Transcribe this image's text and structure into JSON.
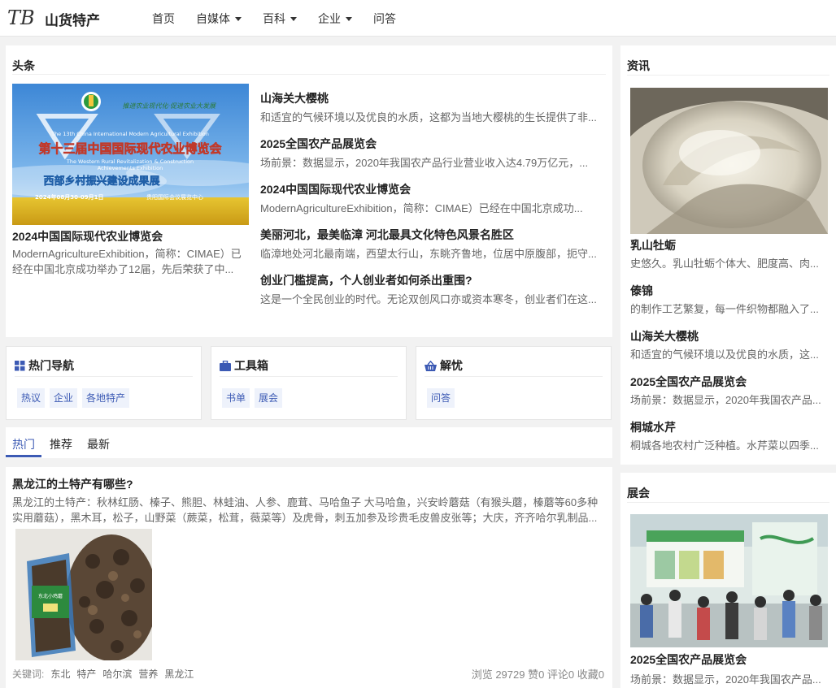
{
  "header": {
    "site_name": "山货特产",
    "logo_text": "TB",
    "nav": [
      {
        "label": "首页",
        "dropdown": false
      },
      {
        "label": "自媒体",
        "dropdown": true
      },
      {
        "label": "百科",
        "dropdown": true
      },
      {
        "label": "企业",
        "dropdown": true
      },
      {
        "label": "问答",
        "dropdown": false
      }
    ]
  },
  "headlines": {
    "title": "头条",
    "banner": {
      "line_top": "推进农业现代化·促进农业大发展",
      "line_en1": "The 13th China International Modern Agricultural Exhibition",
      "line_main": "第十三届中国国际现代农业博览会",
      "line_en2": "The Western Rural Revitalization & Construction",
      "line_en3": "Achievements Exhibition",
      "line_sub": "西部乡村振兴建设成果展",
      "line_date": "2024年08月30-09月1日",
      "line_venue": "贵阳国际会议展览中心"
    },
    "main": {
      "title": "2024中国国际现代农业博览会",
      "desc": "ModernAgricultureExhibition，简称：CIMAE）已经在中国北京成功举办了12届，先后荣获了中..."
    },
    "items": [
      {
        "title": "山海关大樱桃",
        "desc": "和适宜的气候环境以及优良的水质，这都为当地大樱桃的生长提供了非..."
      },
      {
        "title": "2025全国农产品展览会",
        "desc": "场前景：数据显示，2020年我国农产品行业营业收入达4.79万亿元，..."
      },
      {
        "title": "2024中国国际现代农业博览会",
        "desc": "ModernAgricultureExhibition，简称：CIMAE）已经在中国北京成功..."
      },
      {
        "title": "美丽河北，最美临漳 河北最具文化特色风景名胜区",
        "desc": "临漳地处河北最南端，西望太行山，东眺齐鲁地，位居中原腹部，扼守..."
      },
      {
        "title": "创业门槛提高，个人创业者如何杀出重围?",
        "desc": "这是一个全民创业的时代。无论双创风口亦或资本寒冬，创业者们在这..."
      }
    ]
  },
  "tools": [
    {
      "title": "热门导航",
      "icon": "grid-icon",
      "tags": [
        "热议",
        "企业",
        "各地特产"
      ]
    },
    {
      "title": "工具箱",
      "icon": "toolbox-icon",
      "tags": [
        "书单",
        "展会"
      ]
    },
    {
      "title": "解忧",
      "icon": "basket-icon",
      "tags": [
        "问答"
      ]
    }
  ],
  "tabs": {
    "items": [
      "热门",
      "推荐",
      "最新"
    ],
    "active": 0
  },
  "article": {
    "title": "黑龙江的土特产有哪些?",
    "desc": "黑龙江的土特产：秋林红肠、榛子、熊胆、林蛙油、人参、鹿茸、马哈鱼子 大马哈鱼，兴安岭蘑菇（有猴头蘑，榛蘑等60多种实用蘑菇），黑木耳，松子，山野菜（蕨菜，松茸，薇菜等）及虎骨，刺五加参及珍贵毛皮兽皮张等；大庆，齐齐哈尔乳制品...",
    "package_label": "东北小鸡蘑",
    "keywords_label": "关键词:",
    "keywords": [
      "东北",
      "特产",
      "哈尔滨",
      "营养",
      "黑龙江"
    ],
    "stats": "浏览 29729 赞0 评论0 收藏0"
  },
  "news": {
    "title": "资讯",
    "items": [
      {
        "title": "乳山牡蛎",
        "desc": "史悠久。乳山牡蛎个体大、肥度高、肉..."
      },
      {
        "title": "傣锦",
        "desc": "的制作工艺繁复，每一件织物都融入了..."
      },
      {
        "title": "山海关大樱桃",
        "desc": "和适宜的气候环境以及优良的水质，这..."
      },
      {
        "title": "2025全国农产品展览会",
        "desc": "场前景：数据显示，2020年我国农产品..."
      },
      {
        "title": "桐城水芹",
        "desc": "桐城各地农村广泛种植。水芹菜以四季..."
      }
    ]
  },
  "expo": {
    "title": "展会",
    "item_title": "2025全国农产品展览会",
    "item_desc": "场前景：数据显示，2020年我国农产品..."
  }
}
